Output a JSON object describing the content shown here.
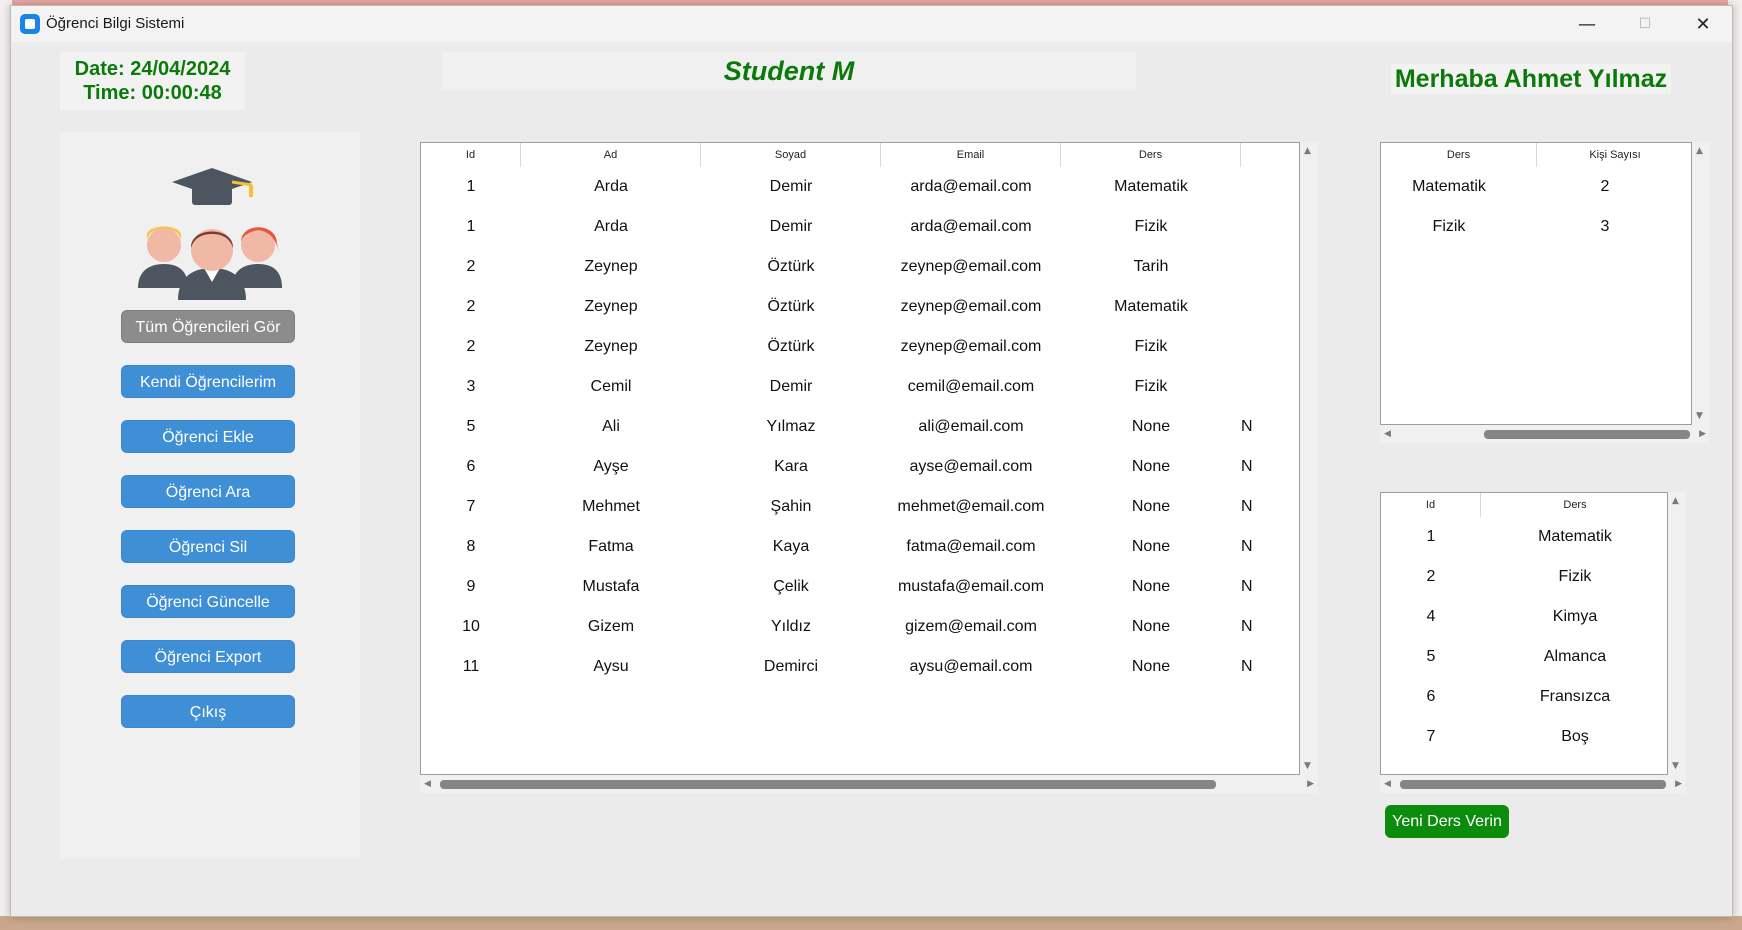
{
  "window": {
    "title": "Öğrenci Bilgi Sistemi",
    "minimize_icon": "—",
    "maximize_icon": "☐",
    "close_icon": "✕"
  },
  "header": {
    "date": "Date: 24/04/2024",
    "time": "Time: 00:00:48",
    "title": "Student M",
    "greeting": "Merhaba Ahmet Yılmaz"
  },
  "sidebar": {
    "buttons": [
      "Tüm Öğrencileri Gör",
      "Kendi Öğrencilerim",
      "Öğrenci Ekle",
      "Öğrenci Ara",
      "Öğrenci Sil",
      "Öğrenci Güncelle",
      "Öğrenci Export",
      "Çıkış"
    ]
  },
  "students_table": {
    "columns": [
      "Id",
      "Ad",
      "Soyad",
      "Email",
      "Ders"
    ],
    "rows": [
      [
        "1",
        "Arda",
        "Demir",
        "arda@email.com",
        "Matematik",
        ""
      ],
      [
        "1",
        "Arda",
        "Demir",
        "arda@email.com",
        "Fizik",
        ""
      ],
      [
        "2",
        "Zeynep",
        "Öztürk",
        "zeynep@email.com",
        "Tarih",
        ""
      ],
      [
        "2",
        "Zeynep",
        "Öztürk",
        "zeynep@email.com",
        "Matematik",
        ""
      ],
      [
        "2",
        "Zeynep",
        "Öztürk",
        "zeynep@email.com",
        "Fizik",
        ""
      ],
      [
        "3",
        "Cemil",
        "Demir",
        "cemil@email.com",
        "Fizik",
        ""
      ],
      [
        "5",
        "Ali",
        "Yılmaz",
        "ali@email.com",
        "None",
        "N"
      ],
      [
        "6",
        "Ayşe",
        "Kara",
        "ayse@email.com",
        "None",
        "N"
      ],
      [
        "7",
        "Mehmet",
        "Şahin",
        "mehmet@email.com",
        "None",
        "N"
      ],
      [
        "8",
        "Fatma",
        "Kaya",
        "fatma@email.com",
        "None",
        "N"
      ],
      [
        "9",
        "Mustafa",
        "Çelik",
        "mustafa@email.com",
        "None",
        "N"
      ],
      [
        "10",
        "Gizem",
        "Yıldız",
        "gizem@email.com",
        "None",
        "N"
      ],
      [
        "11",
        "Aysu",
        "Demirci",
        "aysu@email.com",
        "None",
        "N"
      ]
    ]
  },
  "course_count_table": {
    "columns": [
      "Ders",
      "Kişi Sayısı"
    ],
    "rows": [
      [
        "Matematik",
        "2"
      ],
      [
        "Fizik",
        "3"
      ]
    ]
  },
  "courses_table": {
    "columns": [
      "Id",
      "Ders"
    ],
    "rows": [
      [
        "1",
        "Matematik"
      ],
      [
        "2",
        "Fizik"
      ],
      [
        "4",
        "Kimya"
      ],
      [
        "5",
        "Almanca"
      ],
      [
        "6",
        "Fransızca"
      ],
      [
        "7",
        "Boş"
      ]
    ]
  },
  "scroll_arrows": {
    "up": "▲",
    "down": "▼",
    "left": "◀",
    "right": "▶"
  },
  "new_course_button": "Yeni Ders Verin",
  "colors": {
    "accent_green": "#0b7a0b",
    "button_blue": "#3f8fd6",
    "button_gray": "#8c8c8c"
  }
}
